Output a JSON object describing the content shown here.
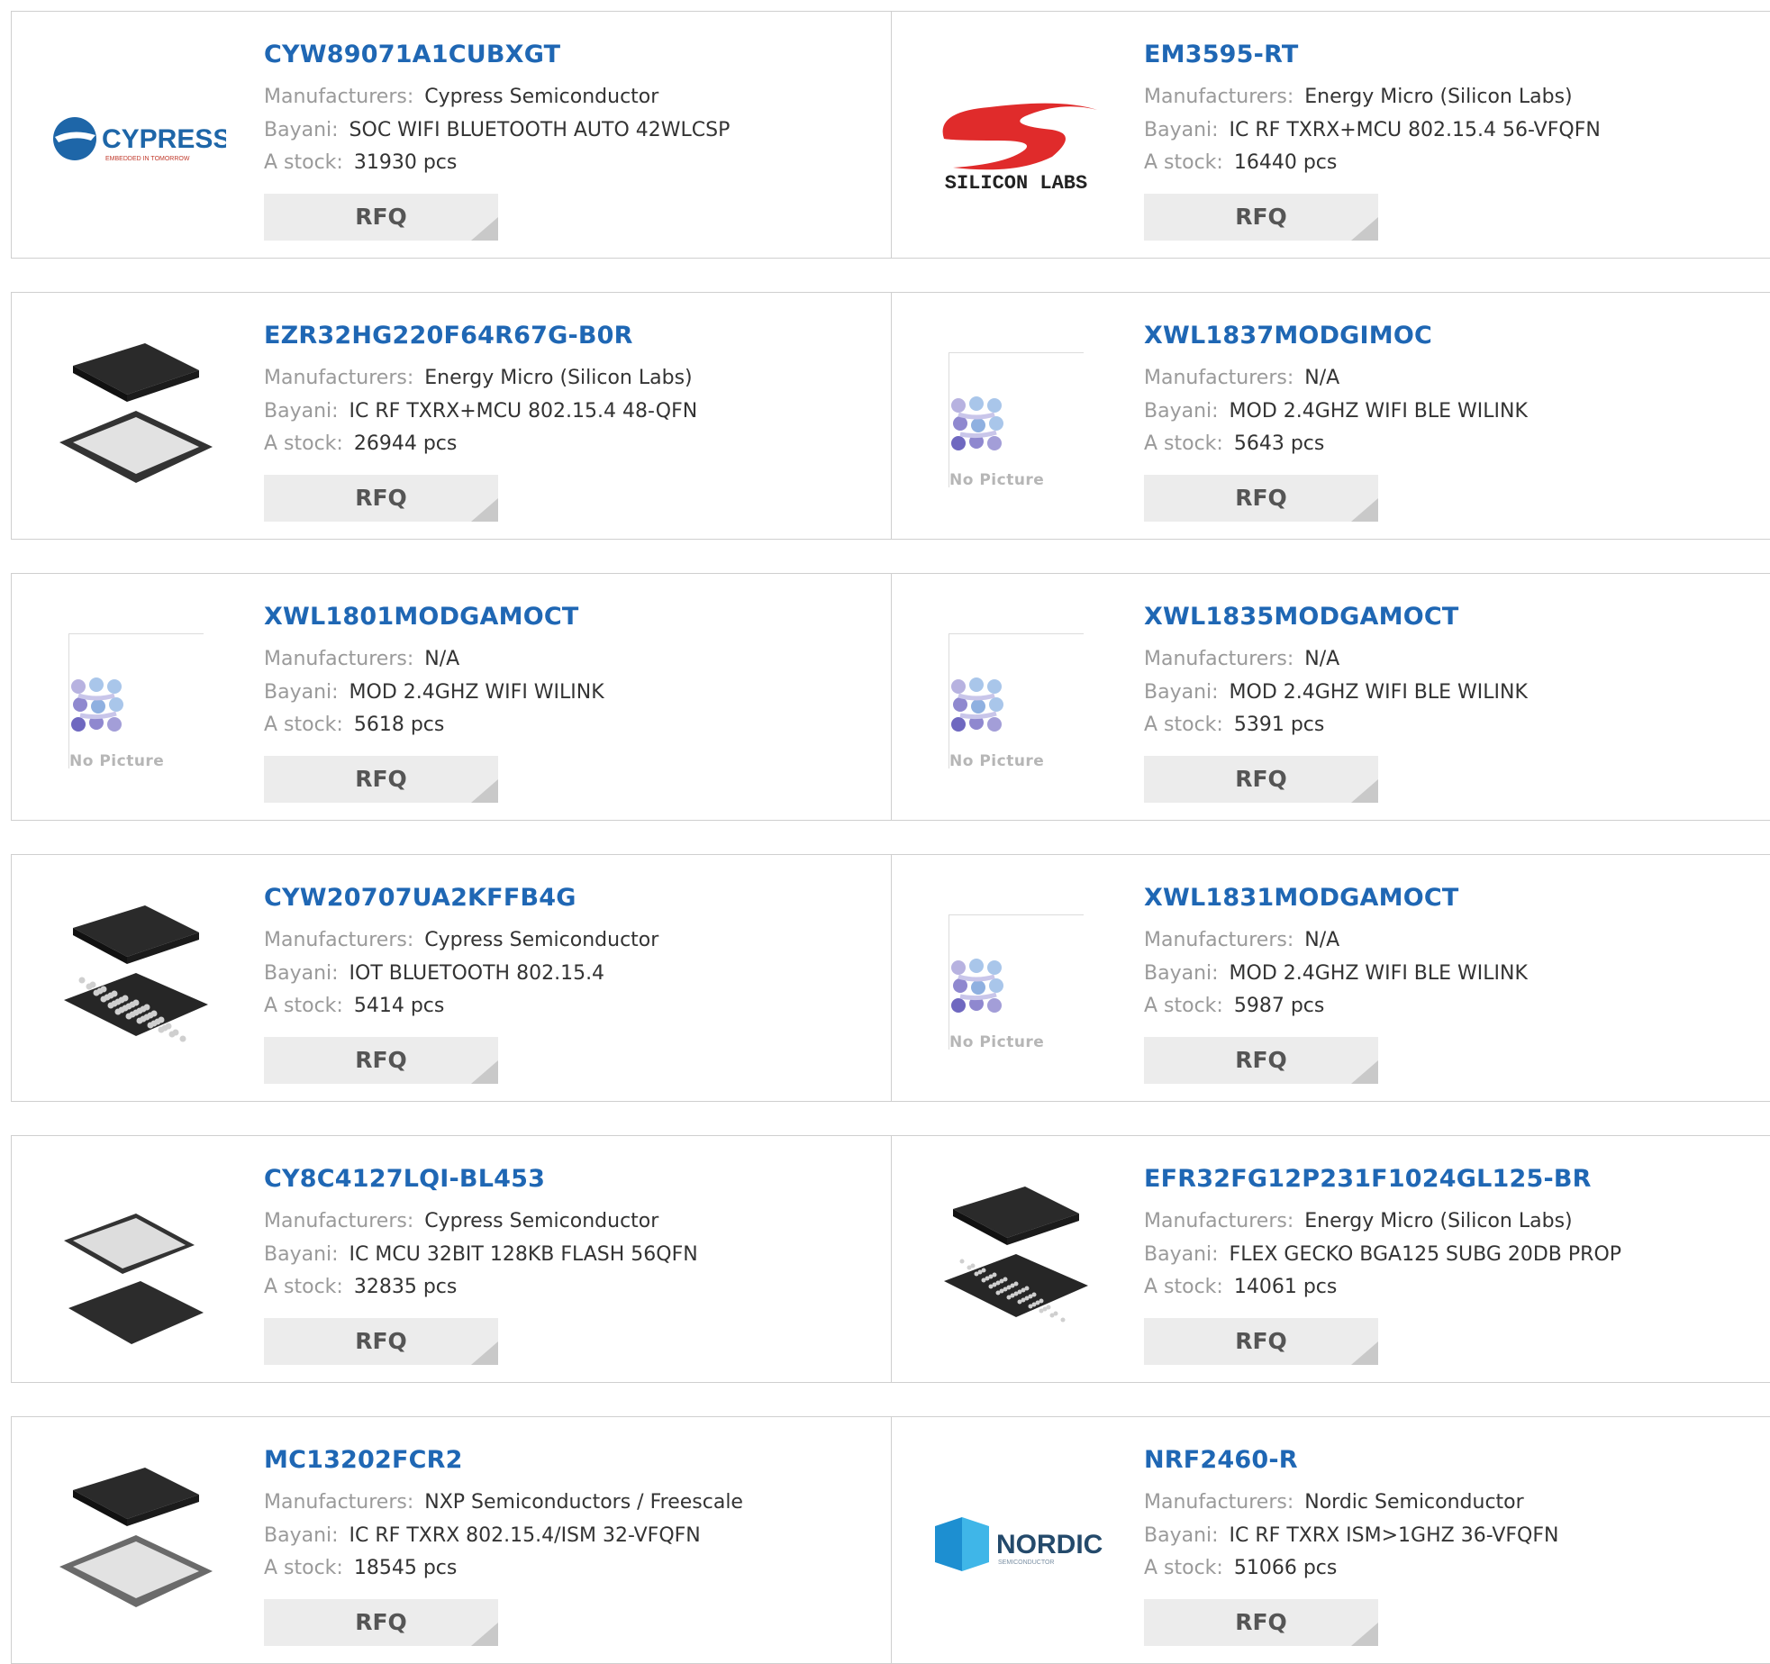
{
  "labels": {
    "manufacturers": "Manufacturers:",
    "description": "Bayani:",
    "stock": "A stock:",
    "rfq": "RFQ",
    "no_picture": "No Picture"
  },
  "products": [
    {
      "part": "CYW89071A1CUBXGT",
      "manufacturer": "Cypress Semiconductor",
      "description": "SOC WIFI BLUETOOTH AUTO 42WLCSP",
      "stock": "31930 pcs",
      "image": "cypress-logo",
      "logo_text": "CYPRESS",
      "logo_subtext": "EMBEDDED IN TOMORROW"
    },
    {
      "part": "EM3595-RT",
      "manufacturer": "Energy Micro (Silicon Labs)",
      "description": "IC RF TXRX+MCU 802.15.4 56-VFQFN",
      "stock": "16440 pcs",
      "image": "silicon-labs-logo",
      "logo_text": "SILICON LABS"
    },
    {
      "part": "EZR32HG220F64R67G-B0R",
      "manufacturer": "Energy Micro (Silicon Labs)",
      "description": "IC RF TXRX+MCU 802.15.4 48-QFN",
      "stock": "26944 pcs",
      "image": "qfn-chip"
    },
    {
      "part": "XWL1837MODGIMOC",
      "manufacturer": "N/A",
      "description": "MOD 2.4GHZ WIFI BLE WILINK",
      "stock": "5643 pcs",
      "image": "no-picture"
    },
    {
      "part": "XWL1801MODGAMOCT",
      "manufacturer": "N/A",
      "description": "MOD 2.4GHZ WIFI WILINK",
      "stock": "5618 pcs",
      "image": "no-picture"
    },
    {
      "part": "XWL1835MODGAMOCT",
      "manufacturer": "N/A",
      "description": "MOD 2.4GHZ WIFI BLE WILINK",
      "stock": "5391 pcs",
      "image": "no-picture"
    },
    {
      "part": "CYW20707UA2KFFB4G",
      "manufacturer": "Cypress Semiconductor",
      "description": "IOT BLUETOOTH 802.15.4",
      "stock": "5414 pcs",
      "image": "bga-chip"
    },
    {
      "part": "XWL1831MODGAMOCT",
      "manufacturer": "N/A",
      "description": "MOD 2.4GHZ WIFI BLE WILINK",
      "stock": "5987 pcs",
      "image": "no-picture"
    },
    {
      "part": "CY8C4127LQI-BL453",
      "manufacturer": "Cypress Semiconductor",
      "description": "IC MCU 32BIT 128KB FLASH 56QFN",
      "stock": "32835 pcs",
      "image": "qfn-chip-flip"
    },
    {
      "part": "EFR32FG12P231F1024GL125-BR",
      "manufacturer": "Energy Micro (Silicon Labs)",
      "description": "FLEX GECKO BGA125 SUBG 20DB PROP",
      "stock": "14061 pcs",
      "image": "bga-fine-chip"
    },
    {
      "part": "MC13202FCR2",
      "manufacturer": "NXP Semiconductors / Freescale",
      "description": "IC RF TXRX 802.15.4/ISM 32-VFQFN",
      "stock": "18545 pcs",
      "image": "qfn-chip-gray"
    },
    {
      "part": "NRF2460-R",
      "manufacturer": "Nordic Semiconductor",
      "description": "IC RF TXRX ISM>1GHZ 36-VFQFN",
      "stock": "51066 pcs",
      "image": "nordic-logo",
      "logo_text": "NORDIC",
      "logo_subtext": "SEMICONDUCTOR"
    }
  ],
  "colors": {
    "link": "#1f67b4",
    "label": "#9a9a9a",
    "button_bg": "#ececec"
  }
}
